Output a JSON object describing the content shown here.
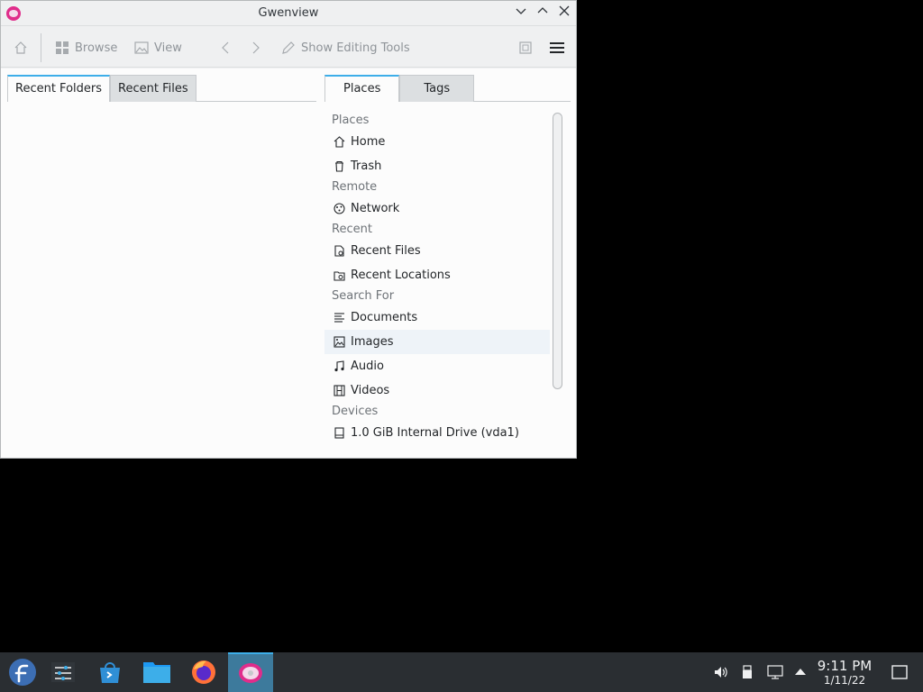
{
  "window": {
    "title": "Gwenview"
  },
  "toolbar": {
    "browse_label": "Browse",
    "view_label": "View",
    "editing_label": "Show Editing Tools"
  },
  "left_tabs": [
    "Recent Folders",
    "Recent Files"
  ],
  "right_tabs": [
    "Places",
    "Tags"
  ],
  "places": {
    "sections": {
      "places": "Places",
      "remote": "Remote",
      "recent": "Recent",
      "search": "Search For",
      "devices": "Devices"
    },
    "items": {
      "home": "Home",
      "trash": "Trash",
      "network": "Network",
      "recent_files": "Recent Files",
      "recent_locations": "Recent Locations",
      "documents": "Documents",
      "images": "Images",
      "audio": "Audio",
      "videos": "Videos",
      "drive": "1.0 GiB Internal Drive (vda1)"
    }
  },
  "taskbar": {
    "time": "9:11 PM",
    "date": "1/11/22"
  },
  "colors": {
    "accent": "#3daee9",
    "taskbar": "#2a2e32",
    "app_pink": "#e02d8b"
  }
}
